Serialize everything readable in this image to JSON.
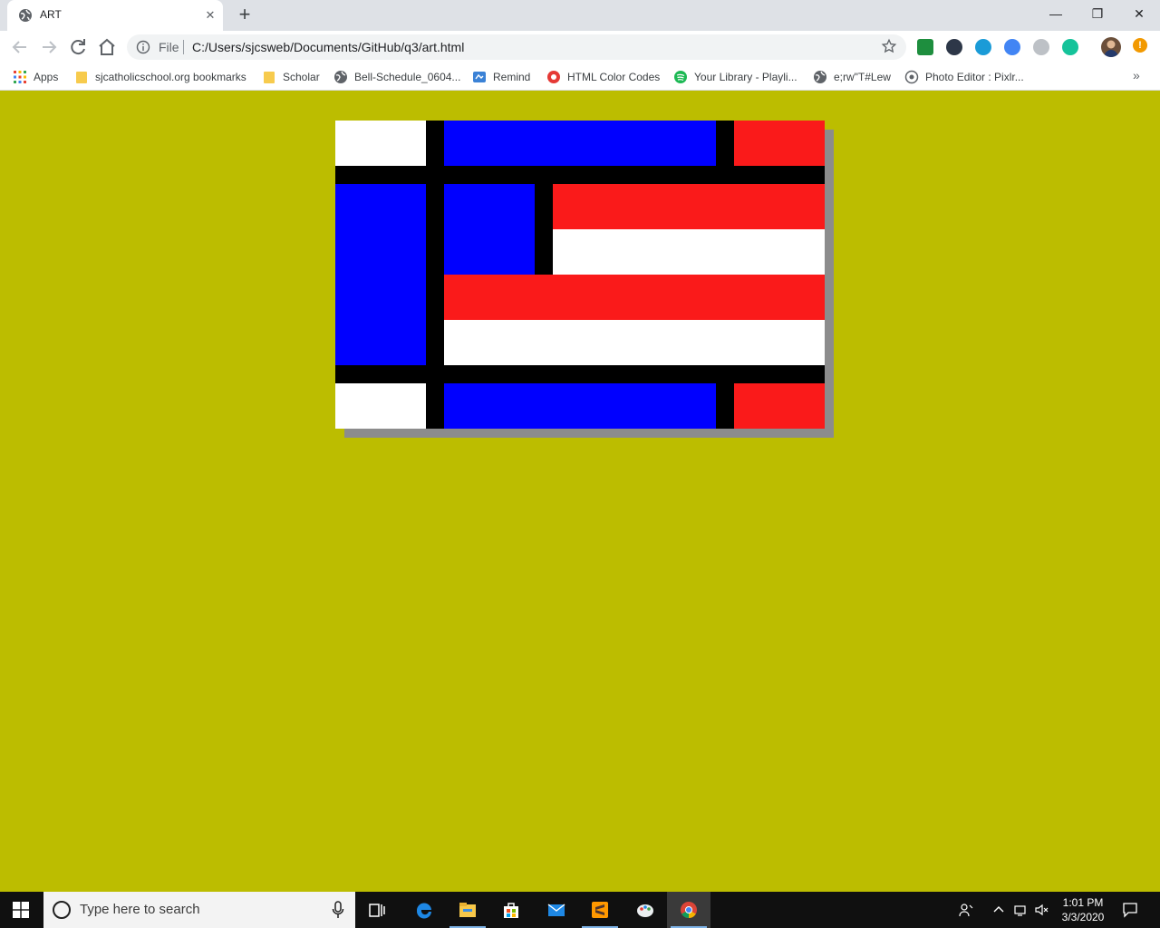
{
  "browser": {
    "tab": {
      "title": "ART",
      "close_glyph": "✕"
    },
    "new_tab_glyph": "+",
    "window_controls": {
      "minimize": "—",
      "restore": "❐",
      "close": "✕"
    },
    "omnibox": {
      "scheme_label": "File",
      "url": "C:/Users/sjcsweb/Documents/GitHub/q3/art.html"
    },
    "extensions": [
      {
        "icon": "google-classroom-icon",
        "color": "#1e8e3e"
      },
      {
        "icon": "shield-extension-icon",
        "color": "#2d3748"
      },
      {
        "icon": "vpn-extension-icon",
        "color": "#1a9bd7"
      },
      {
        "icon": "compass-extension-icon",
        "color": "#4285f4"
      },
      {
        "icon": "help-extension-icon",
        "color": "#bdc1c6"
      },
      {
        "icon": "grammarly-icon",
        "color": "#15c39a"
      }
    ],
    "alert_glyph": "!"
  },
  "bookmarks": {
    "items": [
      {
        "label": "Apps",
        "icon": "apps-grid-icon"
      },
      {
        "label": "sjcatholicschool.org bookmarks",
        "icon": "folder-icon"
      },
      {
        "label": "Scholar",
        "icon": "folder-icon"
      },
      {
        "label": "Bell-Schedule_0604...",
        "icon": "globe-icon"
      },
      {
        "label": "Remind",
        "icon": "remind-icon"
      },
      {
        "label": "HTML Color Codes",
        "icon": "color-codes-icon"
      },
      {
        "label": "Your Library - Playli...",
        "icon": "spotify-icon"
      },
      {
        "label": "e;rw\"T#Lew",
        "icon": "globe-icon"
      },
      {
        "label": "Photo Editor : Pixlr...",
        "icon": "pixlr-icon"
      }
    ],
    "more_glyph": "»"
  },
  "artwork": {
    "background": "#bcbd00",
    "grid_color": "#000000",
    "shadow_color": "#8c8c8c",
    "colors": {
      "white": "#ffffff",
      "blue": "#0000ff",
      "red": "#fa1a1a"
    }
  },
  "taskbar": {
    "search_placeholder": "Type here to search",
    "apps": [
      {
        "name": "task-view-icon",
        "running": false
      },
      {
        "name": "edge-icon",
        "running": false
      },
      {
        "name": "file-explorer-icon",
        "running": true
      },
      {
        "name": "microsoft-store-icon",
        "running": false
      },
      {
        "name": "mail-icon",
        "running": false
      },
      {
        "name": "sublime-text-icon",
        "running": true
      },
      {
        "name": "paint-icon",
        "running": false
      },
      {
        "name": "chrome-icon",
        "running": true
      }
    ],
    "clock": {
      "time": "1:01 PM",
      "date": "3/3/2020"
    }
  }
}
